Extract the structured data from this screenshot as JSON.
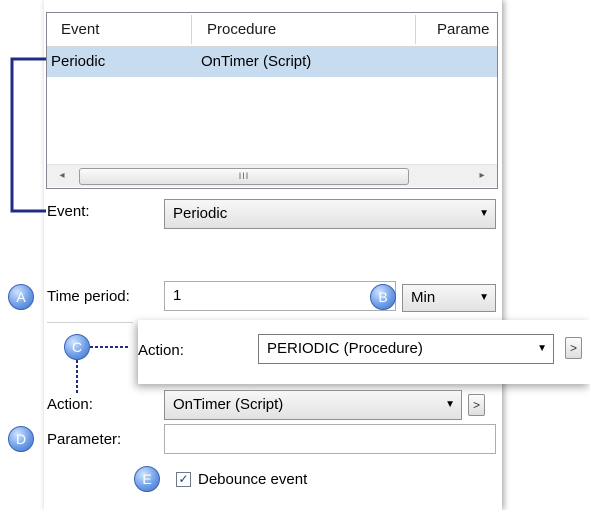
{
  "list": {
    "columns": [
      "Event",
      "Procedure",
      "Parame"
    ],
    "rows": [
      {
        "event": "Periodic",
        "procedure": "OnTimer (Script)"
      }
    ],
    "scrollbar": {
      "left_arrow": "◂",
      "right_arrow": "▸",
      "grip": "III"
    }
  },
  "event": {
    "label": "Event:",
    "value": "Periodic"
  },
  "time_period": {
    "badge": "A",
    "label": "Time period:",
    "value": "1",
    "unit_badge": "B",
    "unit": "Min"
  },
  "popup_action": {
    "badge": "C",
    "label": "Action:",
    "value": "PERIODIC (Procedure)",
    "more": ">"
  },
  "action": {
    "label": "Action:",
    "value": "OnTimer (Script)",
    "more": ">"
  },
  "parameter": {
    "badge": "D",
    "label": "Parameter:",
    "value": ""
  },
  "debounce": {
    "badge": "E",
    "label": "Debounce event",
    "checked": true,
    "check_mark": "✓"
  },
  "dropdown_arrow": "▼",
  "colors": {
    "selection": "#c8dcef",
    "callout_line": "#1f2d86",
    "badge": "#6f9ee8"
  }
}
